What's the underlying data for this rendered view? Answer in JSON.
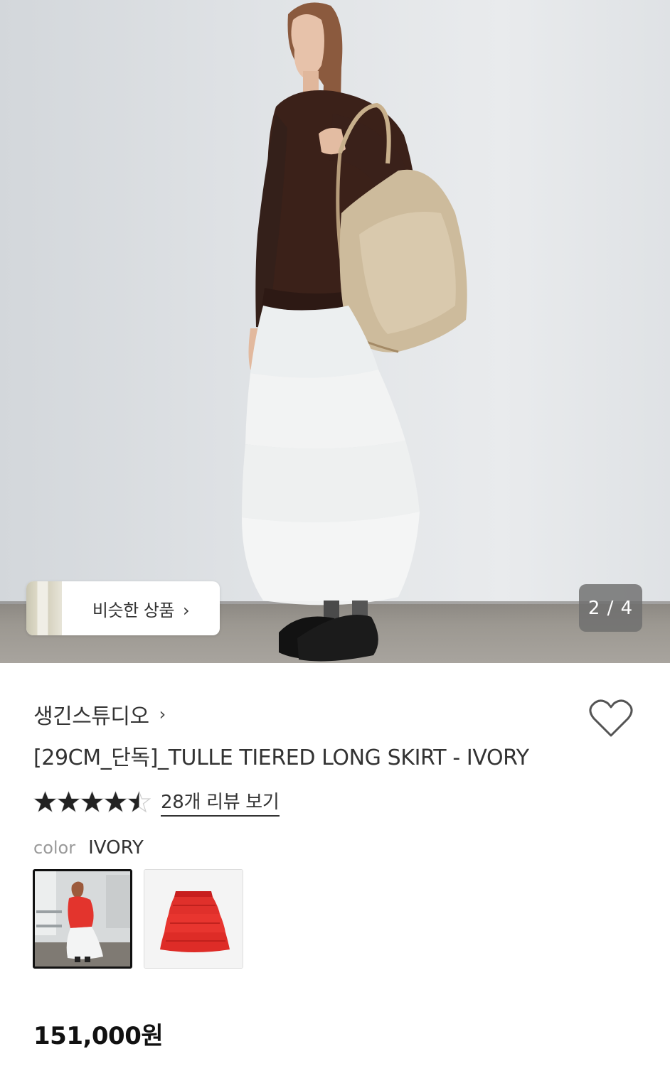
{
  "hero": {
    "similar_products_label": "비슷한 상품",
    "similar_products_chevron": "›",
    "page_indicator": "2 / 4"
  },
  "product": {
    "brand": "생긴스튜디오",
    "brand_chevron": "›",
    "title": "[29CM_단독]_TULLE TIERED LONG SKIRT - IVORY",
    "rating": 4.5,
    "rating_max": 5,
    "review_link": "28개 리뷰 보기",
    "color_key": "color",
    "color_value": "IVORY",
    "swatches": [
      {
        "name": "IVORY",
        "selected": true
      },
      {
        "name": "RED",
        "selected": false
      }
    ],
    "price": "151,000원"
  },
  "icons": {
    "heart": "heart-outline-icon",
    "star": "star-icon",
    "chevron": "chevron-right-icon"
  },
  "colors": {
    "text_primary": "#333333",
    "text_muted": "#999999",
    "star": "#222222",
    "swatch_selected_border": "#111111",
    "skirt_red": "#e02826"
  }
}
